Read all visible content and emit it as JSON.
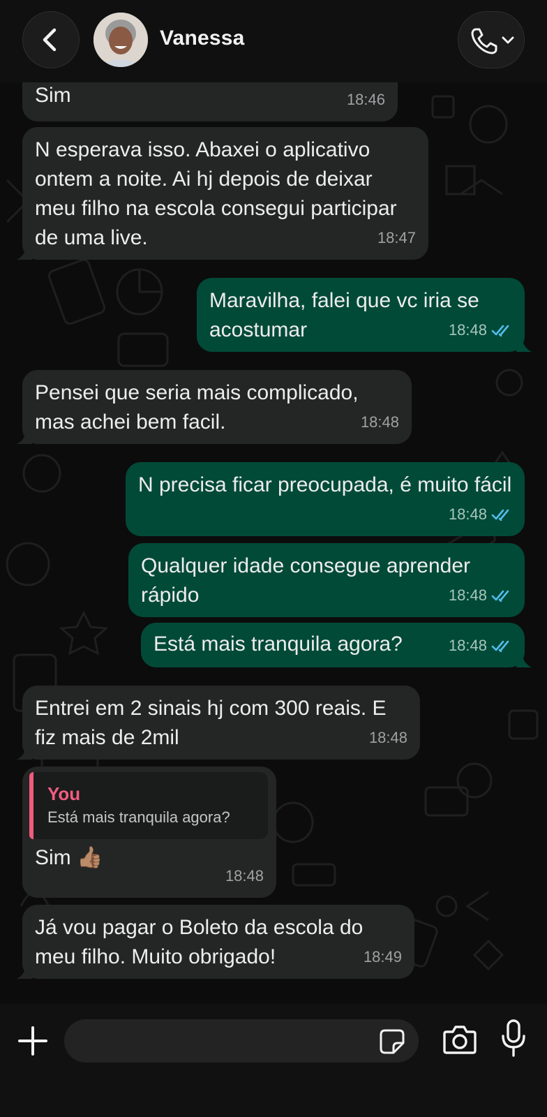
{
  "header": {
    "contact_name": "Vanessa"
  },
  "messages": [
    {
      "dir": "in",
      "text": "Sim",
      "time": "18:46"
    },
    {
      "dir": "in",
      "text": "N esperava isso. Abaxei o aplicativo ontem a noite. Ai hj depois de deixar meu filho na escola consegui participar de uma live.",
      "time": "18:47"
    },
    {
      "dir": "out",
      "text": "Maravilha, falei que vc iria se acostumar",
      "time": "18:48",
      "read": true
    },
    {
      "dir": "in",
      "text": "Pensei que seria mais complicado, mas achei bem facil.",
      "time": "18:48"
    },
    {
      "dir": "out",
      "text": "N precisa ficar preocupada, é muito fácil",
      "time": "18:48",
      "read": true
    },
    {
      "dir": "out",
      "text": "Qualquer idade consegue aprender rápido",
      "time": "18:48",
      "read": true
    },
    {
      "dir": "out",
      "text": "Está mais tranquila agora?",
      "time": "18:48",
      "read": true
    },
    {
      "dir": "in",
      "text": "Entrei em 2 sinais hj com 300 reais. E fiz mais de 2mil",
      "time": "18:48"
    },
    {
      "dir": "in",
      "reply_author": "You",
      "reply_text": "Está mais tranquila agora?",
      "text": "Sim 👍🏽",
      "time": "18:48"
    },
    {
      "dir": "in",
      "text": "Já vou pagar o Boleto da escola do meu filho. Muito obrigado!",
      "time": "18:49"
    }
  ],
  "composer": {
    "input_value": "",
    "icons": [
      "plus-icon",
      "sticker-icon",
      "camera-icon",
      "microphone-icon"
    ]
  },
  "colors": {
    "incoming_bubble": "#242626",
    "outgoing_bubble": "#024a38",
    "read_ticks": "#53bdeb",
    "reply_accent": "#f25c80"
  }
}
